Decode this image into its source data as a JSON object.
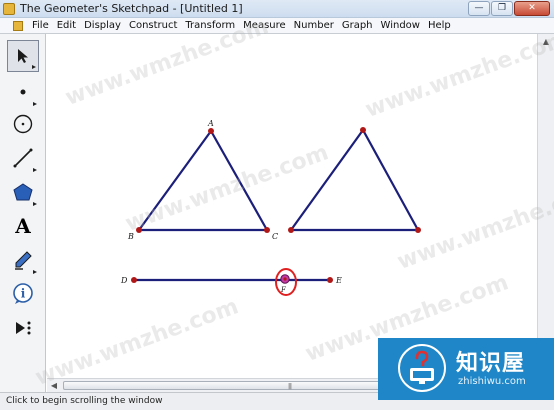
{
  "window": {
    "title": "The Geometer's Sketchpad - [Untitled 1]",
    "minimize_icon": "minimize-icon",
    "maximize_icon": "restore-icon",
    "close_icon": "close-icon"
  },
  "menubar": {
    "items": [
      "File",
      "Edit",
      "Display",
      "Construct",
      "Transform",
      "Measure",
      "Number",
      "Graph",
      "Window",
      "Help"
    ]
  },
  "toolbox": {
    "tools": [
      {
        "name": "selection-arrow-tool",
        "icon": "arrow-icon"
      },
      {
        "name": "point-tool",
        "icon": "point-icon"
      },
      {
        "name": "compass-tool",
        "icon": "circle-icon"
      },
      {
        "name": "straightedge-tool",
        "icon": "line-icon"
      },
      {
        "name": "polygon-tool",
        "icon": "polygon-icon"
      },
      {
        "name": "text-tool",
        "icon": "text-icon",
        "glyph": "A"
      },
      {
        "name": "marker-tool",
        "icon": "pencil-icon"
      },
      {
        "name": "information-tool",
        "icon": "info-icon",
        "glyph": "i"
      },
      {
        "name": "custom-tool",
        "icon": "play-dots-icon"
      }
    ]
  },
  "sketch": {
    "colors": {
      "segment": "#1c1f7a",
      "point": "#b01818",
      "highlight": "#e02020"
    },
    "triangle1": {
      "labels": {
        "A": "A",
        "B": "B",
        "C": "C"
      }
    },
    "segment": {
      "labels": {
        "D": "D",
        "E": "E",
        "F": "F"
      }
    }
  },
  "statusbar": {
    "text": "Click to begin scrolling the window"
  },
  "watermarks": [
    "www.wmzhe.com",
    "www.wmzhe.com",
    "www.wmzhe.com",
    "www.wmzhe.com",
    "www.wmzhe.com",
    "www.wmzhe.com"
  ],
  "logo": {
    "title": "知识屋",
    "subtitle": "zhishiwu.com",
    "icon": "question-monitor-icon"
  }
}
